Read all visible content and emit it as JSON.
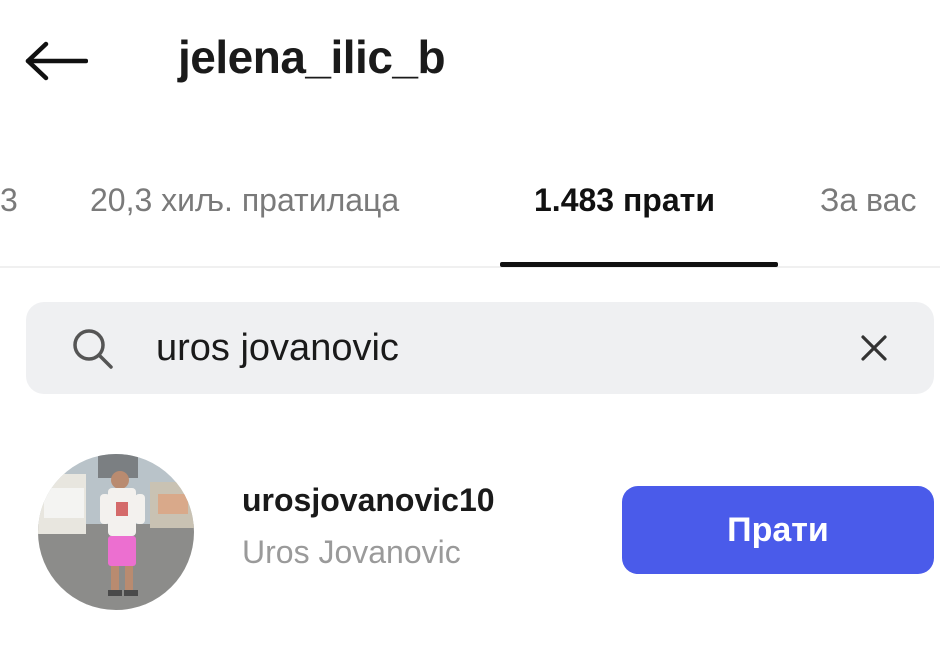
{
  "header": {
    "title": "jelena_ilic_b",
    "back_icon": "arrow-left-icon"
  },
  "tabs": [
    {
      "label": "3",
      "active": false
    },
    {
      "label": "20,3 хиљ. пратилаца",
      "active": false
    },
    {
      "label": "1.483 прати",
      "active": true
    },
    {
      "label": "За вас",
      "active": false
    }
  ],
  "search": {
    "value": "uros jovanovic",
    "icon": "search-icon",
    "clear_icon": "close-icon"
  },
  "results": [
    {
      "username": "urosjovanovic10",
      "full_name": "Uros Jovanovic",
      "follow_label": "Прати"
    }
  ],
  "colors": {
    "accent": "#4a5bea",
    "search_bg": "#eff0f2",
    "secondary_text": "#9a9a9a"
  }
}
